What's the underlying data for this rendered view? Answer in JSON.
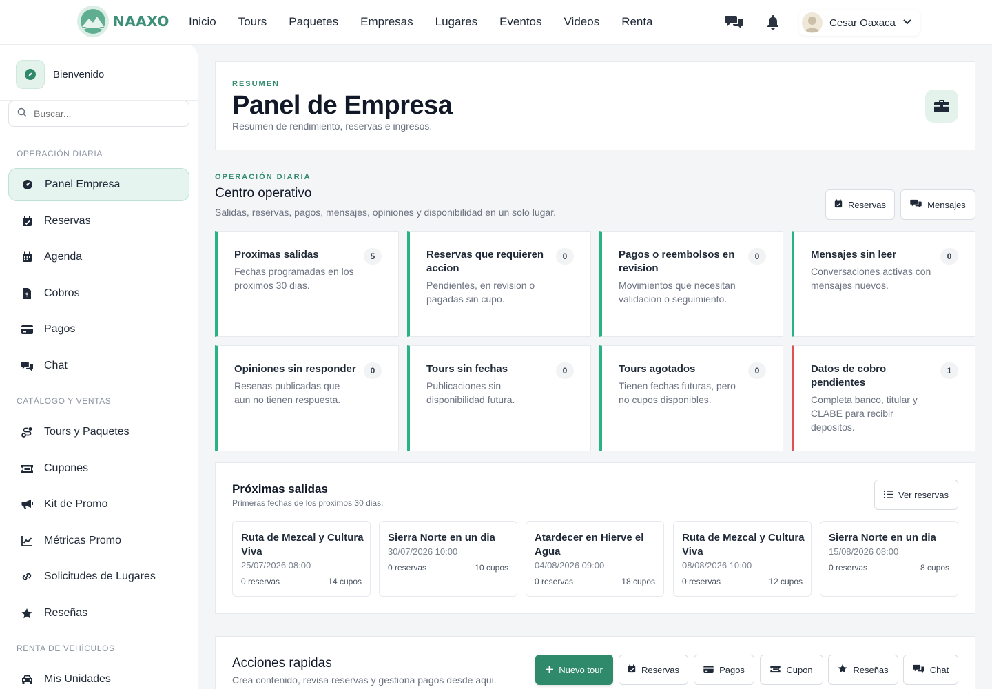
{
  "brand": {
    "name": "NAAXO",
    "accent": "#2f8a6b"
  },
  "nav": [
    "Inicio",
    "Tours",
    "Paquetes",
    "Empresas",
    "Lugares",
    "Eventos",
    "Videos",
    "Renta"
  ],
  "user": {
    "name": "Cesar Oaxaca"
  },
  "sidebar": {
    "welcome": "Bienvenido",
    "search_placeholder": "Buscar...",
    "sections": [
      {
        "title": "OPERACIÓN DIARIA",
        "items": [
          {
            "label": "Panel Empresa",
            "icon": "dashboard-icon",
            "active": true
          },
          {
            "label": "Reservas",
            "icon": "calendar-check-icon"
          },
          {
            "label": "Agenda",
            "icon": "calendar-icon"
          },
          {
            "label": "Cobros",
            "icon": "invoice-icon"
          },
          {
            "label": "Pagos",
            "icon": "credit-card-icon"
          },
          {
            "label": "Chat",
            "icon": "chat-icon"
          }
        ]
      },
      {
        "title": "CATÁLOGO Y VENTAS",
        "items": [
          {
            "label": "Tours y Paquetes",
            "icon": "route-icon"
          },
          {
            "label": "Cupones",
            "icon": "ticket-icon"
          },
          {
            "label": "Kit de Promo",
            "icon": "megaphone-icon"
          },
          {
            "label": "Métricas Promo",
            "icon": "line-chart-icon"
          },
          {
            "label": "Solicitudes de Lugares",
            "icon": "link-icon"
          },
          {
            "label": "Reseñas",
            "icon": "star-icon"
          }
        ]
      },
      {
        "title": "RENTA DE VEHÍCULOS",
        "items": [
          {
            "label": "Mis Unidades",
            "icon": "car-icon"
          }
        ]
      }
    ]
  },
  "hero": {
    "eyebrow": "RESUMEN",
    "title": "Panel de Empresa",
    "subtitle": "Resumen de rendimiento, reservas e ingresos."
  },
  "ops": {
    "eyebrow": "OPERACIÓN DIARIA",
    "title": "Centro operativo",
    "subtitle": "Salidas, reservas, pagos, mensajes, opiniones y disponibilidad en un solo lugar.",
    "btn_reservas": "Reservas",
    "btn_mensajes": "Mensajes",
    "cards": [
      {
        "title": "Proximas salidas",
        "desc": "Fechas programadas en los proximos 30 dias.",
        "count": "5",
        "status": "ok"
      },
      {
        "title": "Reservas que requieren accion",
        "desc": "Pendientes, en revision o pagadas sin cupo.",
        "count": "0",
        "status": "ok"
      },
      {
        "title": "Pagos o reembolsos en revision",
        "desc": "Movimientos que necesitan validacion o seguimiento.",
        "count": "0",
        "status": "ok"
      },
      {
        "title": "Mensajes sin leer",
        "desc": "Conversaciones activas con mensajes nuevos.",
        "count": "0",
        "status": "ok"
      },
      {
        "title": "Opiniones sin responder",
        "desc": "Resenas publicadas que aun no tienen respuesta.",
        "count": "0",
        "status": "ok"
      },
      {
        "title": "Tours sin fechas",
        "desc": "Publicaciones sin disponibilidad futura.",
        "count": "0",
        "status": "ok"
      },
      {
        "title": "Tours agotados",
        "desc": "Tienen fechas futuras, pero no cupos disponibles.",
        "count": "0",
        "status": "ok"
      },
      {
        "title": "Datos de cobro pendientes",
        "desc": "Completa banco, titular y CLABE para recibir depositos.",
        "count": "1",
        "status": "warn"
      }
    ]
  },
  "departures": {
    "title": "Próximas salidas",
    "subtitle": "Primeras fechas de los proximos 30 dias.",
    "btn_label": "Ver reservas",
    "items": [
      {
        "name": "Ruta de Mezcal y Cultura Viva",
        "date": "25/07/2026 08:00",
        "reservas": "0 reservas",
        "cupos": "14 cupos"
      },
      {
        "name": "Sierra Norte en un dia",
        "date": "30/07/2026 10:00",
        "reservas": "0 reservas",
        "cupos": "10 cupos"
      },
      {
        "name": "Atardecer en Hierve el Agua",
        "date": "04/08/2026 09:00",
        "reservas": "0 reservas",
        "cupos": "18 cupos"
      },
      {
        "name": "Ruta de Mezcal y Cultura Viva",
        "date": "08/08/2026 10:00",
        "reservas": "0 reservas",
        "cupos": "12 cupos"
      },
      {
        "name": "Sierra Norte en un dia",
        "date": "15/08/2026 08:00",
        "reservas": "0 reservas",
        "cupos": "8 cupos"
      }
    ]
  },
  "quick": {
    "title": "Acciones rapidas",
    "subtitle": "Crea contenido, revisa reservas y gestiona pagos desde aqui.",
    "buttons": [
      "Nuevo tour",
      "Reservas",
      "Pagos",
      "Cupon",
      "Reseñas",
      "Chat"
    ]
  }
}
